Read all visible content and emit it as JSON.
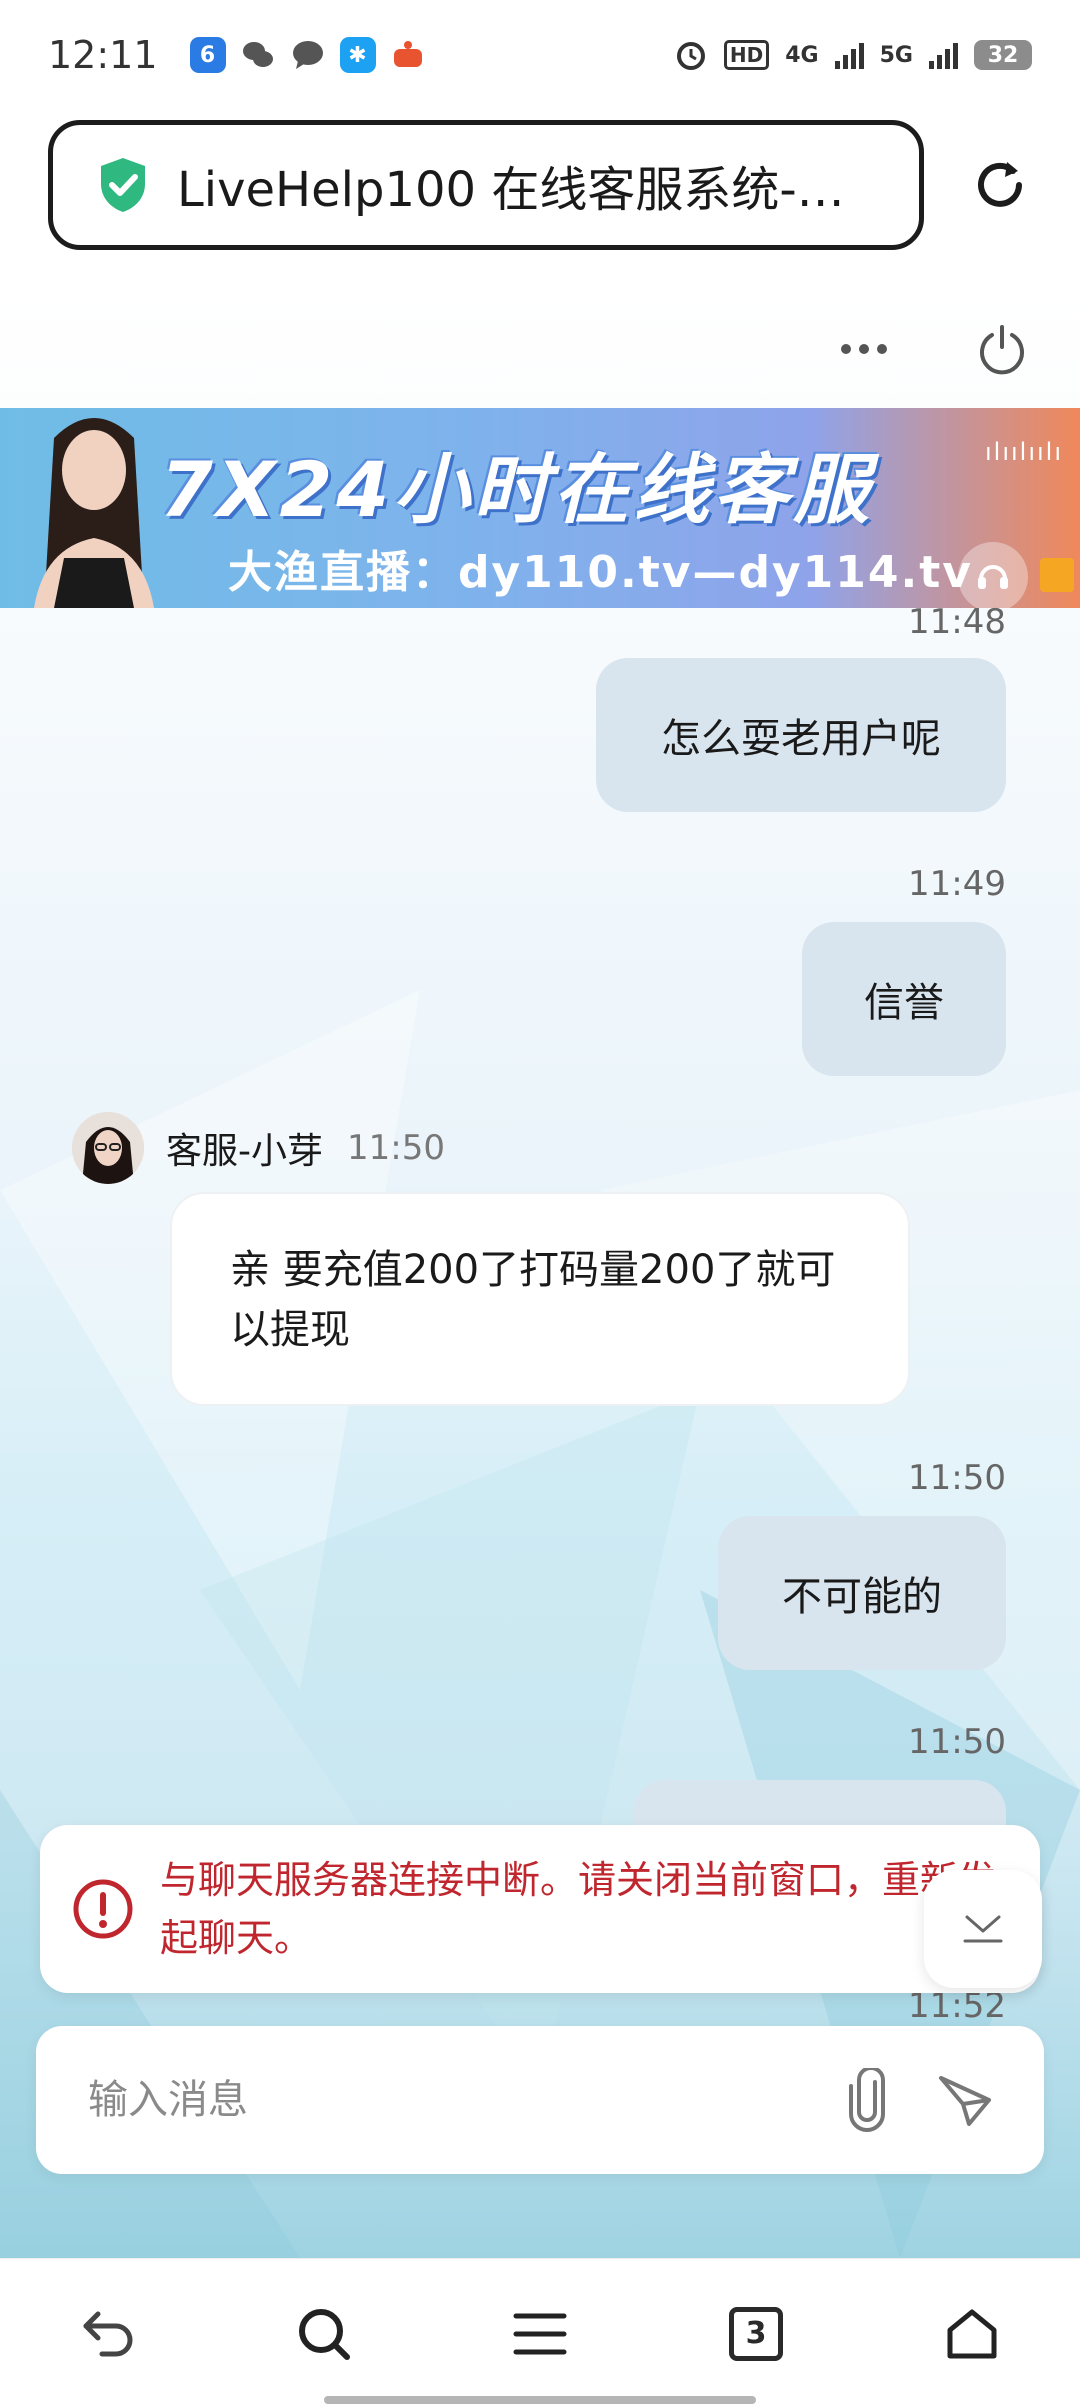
{
  "status_bar": {
    "time": "12:11",
    "network_hd": "HD",
    "network_4g": "4G",
    "network_5g": "5G",
    "battery": "32"
  },
  "browser": {
    "url_title": "LiveHelp100 在线客服系统-…",
    "tab_count": "3"
  },
  "banner": {
    "title": "7X24小时在线客服",
    "subtitle": "大渔直播：dy110.tv—dy114.tv"
  },
  "messages": [
    {
      "time": "11:48",
      "text": "怎么耍老用户呢"
    },
    {
      "time": "11:49",
      "text": "信誉"
    },
    {
      "agent": "客服-小芽",
      "time": "11:50",
      "text": "亲 要充值200了打码量200了就可以提现"
    },
    {
      "time": "11:50",
      "text": "不可能的"
    },
    {
      "time": "11:50",
      "text": ""
    },
    {
      "time": "11:52",
      "text": ""
    }
  ],
  "alert": {
    "text": "与聊天服务器连接中断。请关闭当前窗口，重新发起聊天。"
  },
  "composer": {
    "placeholder": "输入消息"
  },
  "colors": {
    "accent_green": "#2fb880",
    "alert_red": "#c0262d",
    "outgoing_bubble": "#d9e5ee"
  }
}
